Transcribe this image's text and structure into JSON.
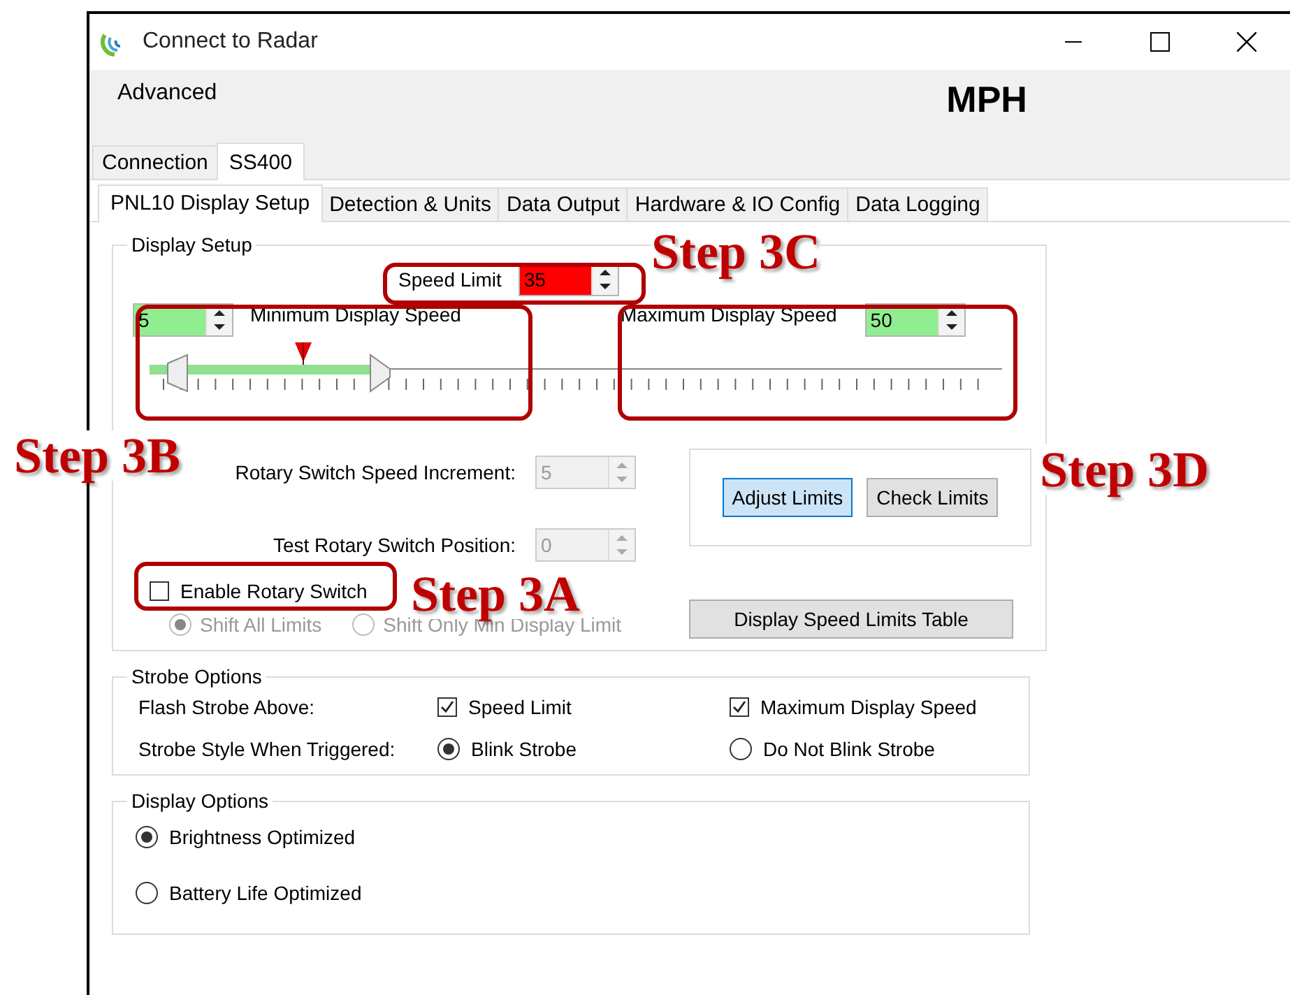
{
  "window": {
    "title": "Connect to Radar"
  },
  "menu": [
    "Advanced"
  ],
  "unit_label": "MPH",
  "outer_tabs": [
    {
      "label": "Connection",
      "selected": false
    },
    {
      "label": "SS400",
      "selected": true
    }
  ],
  "inner_tabs": [
    {
      "label": "PNL10 Display Setup",
      "selected": true
    },
    {
      "label": "Detection & Units",
      "selected": false
    },
    {
      "label": "Data Output",
      "selected": false
    },
    {
      "label": "Hardware & IO Config",
      "selected": false
    },
    {
      "label": "Data Logging",
      "selected": false
    }
  ],
  "display_setup": {
    "title": "Display Setup",
    "speed_limit": {
      "label": "Speed Limit",
      "value": "35",
      "color": "#ff0000"
    },
    "min_speed": {
      "label": "Minimum Display Speed",
      "value": "5",
      "color": "#90ee90"
    },
    "max_speed": {
      "label": "Maximum Display Speed",
      "value": "50",
      "color": "#90ee90"
    },
    "slider": {
      "level": 0.26,
      "marker": {
        "level": 0.18
      }
    },
    "increment": {
      "label": "Rotary Switch Speed Increment:",
      "value": "5",
      "disabled": true
    },
    "position": {
      "label": "Test Rotary Switch Position:",
      "value": "0",
      "disabled": true
    },
    "enable_rotary": {
      "label": "Enable Rotary Switch",
      "checked": false
    },
    "shift_modes": [
      {
        "label": "Shift All Limits",
        "selected": true,
        "disabled": true
      },
      {
        "label": "Shift Only Min Display Limit",
        "selected": false,
        "disabled": true
      }
    ],
    "limit_buttons": [
      {
        "label": "Adjust Limits",
        "focused": true
      },
      {
        "label": "Check Limits",
        "focused": false
      }
    ],
    "table_button": "Display Speed Limits Table"
  },
  "strobe_options": {
    "title": "Strobe Options",
    "flash_label": "Flash Strobe Above:",
    "flash_items": [
      {
        "label": "Speed Limit",
        "checked": true
      },
      {
        "label": "Maximum Display Speed",
        "checked": true
      }
    ],
    "style_label": "Strobe Style When Triggered:",
    "style_items": [
      {
        "label": "Blink Strobe",
        "selected": true
      },
      {
        "label": "Do Not Blink Strobe",
        "selected": false
      }
    ]
  },
  "display_options": {
    "title": "Display Options",
    "items": [
      {
        "label": "Brightness Optimized",
        "selected": true
      },
      {
        "label": "Battery Life Optimized",
        "selected": false
      }
    ]
  },
  "annotations": [
    {
      "label": "Step 3C",
      "kind": "c"
    },
    {
      "label": "Step 3B",
      "kind": "b"
    },
    {
      "label": "Step 3D",
      "kind": "d"
    },
    {
      "label": "Step 3A",
      "kind": "a"
    }
  ]
}
